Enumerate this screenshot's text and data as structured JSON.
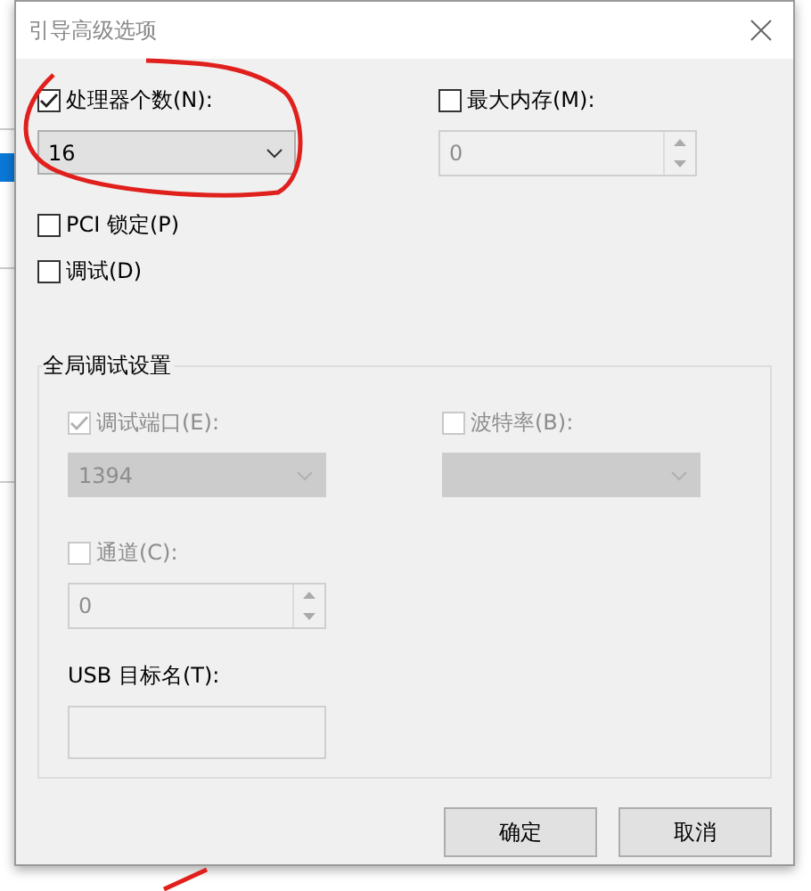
{
  "window": {
    "title": "引导高级选项"
  },
  "processor_count": {
    "label": "处理器个数(N):",
    "checked": true,
    "value": "16"
  },
  "max_memory": {
    "label": "最大内存(M):",
    "checked": false,
    "value": "0",
    "disabled": true
  },
  "checkboxes": [
    {
      "label": "PCI 锁定(P)",
      "checked": false
    },
    {
      "label": "调试(D)",
      "checked": false
    }
  ],
  "global_debug": {
    "title": "全局调试设置",
    "debug_port": {
      "label": "调试端口(E):",
      "checked": true,
      "disabled": true,
      "value": "1394"
    },
    "baud_rate": {
      "label": "波特率(B):",
      "checked": false,
      "disabled": true
    },
    "channel": {
      "label": "通道(C):",
      "checked": false,
      "disabled": true,
      "value": "0"
    },
    "usb_target": {
      "label": "USB 目标名(T):",
      "disabled": true
    }
  },
  "buttons": [
    {
      "label": "确定"
    },
    {
      "label": "取消"
    }
  ]
}
